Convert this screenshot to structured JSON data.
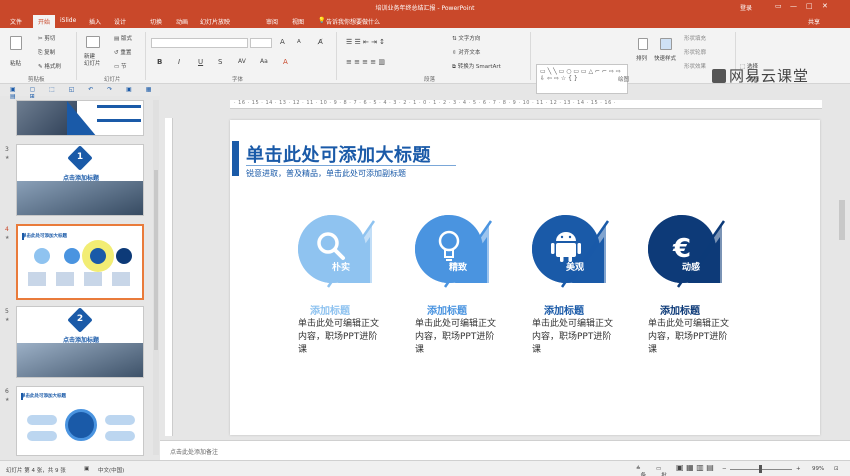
{
  "titlebar": {
    "title": "培训业务年终总结汇报 - PowerPoint",
    "login": "登录",
    "min": "▭",
    "restore": "—",
    "max": "□",
    "close": "✕"
  },
  "tabs": [
    "文件",
    "开始",
    "iSlide",
    "插入",
    "设计",
    "切换",
    "动画",
    "幻灯片放映",
    "审阅",
    "视图"
  ],
  "search_hint": "告诉我你想要做什么",
  "share": "共享",
  "ribbon": {
    "clipboard": {
      "paste": "粘贴",
      "cut": "剪切",
      "copy": "复制",
      "format_painter": "格式刷",
      "label": "剪贴板"
    },
    "slides": {
      "new_slide": "新建\n幻灯片",
      "layout": "版式",
      "reset": "重置",
      "section": "节",
      "label": "幻灯片"
    },
    "font": {
      "label": "字体",
      "bold": "B",
      "italic": "I",
      "underline": "U",
      "strike": "S",
      "grow": "A",
      "shrink": "A"
    },
    "paragraph": {
      "label": "段落",
      "text_direction": "文字方向",
      "align_text": "对齐文本",
      "smartart": "转换为 SmartArt"
    },
    "drawing": {
      "label": "绘图",
      "arrange": "排列",
      "quick_styles": "快速样式",
      "fill": "形状填充",
      "outline": "形状轮廓",
      "effects": "形状效果"
    },
    "editing": {
      "label": "编辑",
      "select": "选择"
    }
  },
  "watermark": "网易云课堂",
  "thumbs": [
    {
      "num": "3",
      "title": "点击添加标题",
      "num_badge": "1"
    },
    {
      "num": "4",
      "title": "单击此处可添加大标题"
    },
    {
      "num": "5",
      "title": "点击添加标题",
      "num_badge": "2"
    },
    {
      "num": "6",
      "title": "单击此处可添加大标题"
    }
  ],
  "ruler_text": "· 16 · 15 · 14 · 13 · 12 · 11 · 10 · 9 · 8 · 7 · 6 · 5 · 4 · 3 · 2 · 1 · 0 · 1 · 2 · 3 · 4 · 5 · 6 · 7 · 8 · 9 · 10 · 11 · 12 · 13 · 14 · 15 · 16 ·",
  "slide": {
    "title": "单击此处可添加大标题",
    "subtitle": "锐意进取，普及精品，单击此处可添加副标题",
    "features": [
      {
        "tag": "朴实",
        "title": "添加标题",
        "desc": "单击此处可编辑正文内容，职场PPT进阶课",
        "color": "#8fc3f0",
        "title_color": "#8fc3f0",
        "icon": "search-icon"
      },
      {
        "tag": "精致",
        "title": "添加标题",
        "desc": "单击此处可编辑正文内容，职场PPT进阶课",
        "color": "#4a94e0",
        "title_color": "#4a94e0",
        "icon": "lightbulb-icon"
      },
      {
        "tag": "美观",
        "title": "添加标题",
        "desc": "单击此处可编辑正文内容，职场PPT进阶课",
        "color": "#1a5aa8",
        "title_color": "#1a5aa8",
        "icon": "android-icon"
      },
      {
        "tag": "动感",
        "title": "添加标题",
        "desc": "单击此处可编辑正文内容，职场PPT进阶课",
        "color": "#0d3a78",
        "title_color": "#0d3a78",
        "icon": "euro-icon"
      }
    ]
  },
  "notes": "点击此处添加备注",
  "status": {
    "slide_info": "幻灯片 第 4 张，共 9 张",
    "language": "中文(中国)",
    "notes_btn": "备注",
    "comments_btn": "批注",
    "zoom": "99%"
  }
}
